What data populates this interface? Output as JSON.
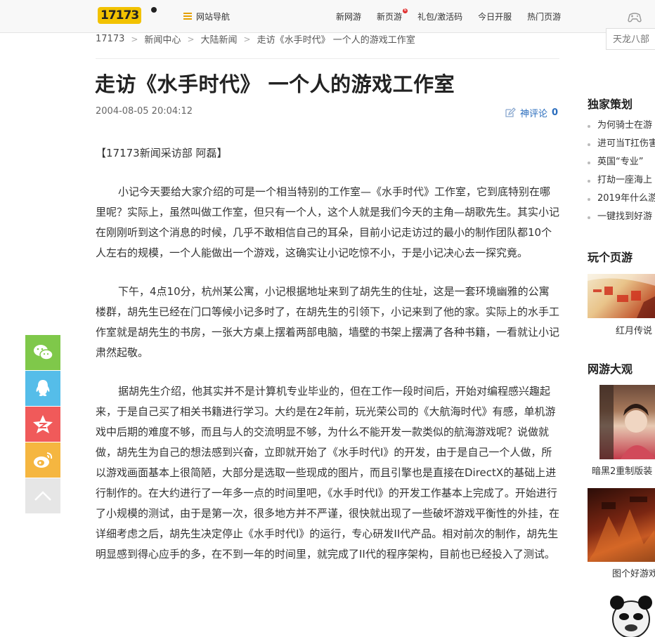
{
  "header": {
    "logo_text": "17173",
    "site_nav_label": "网站导航",
    "menu": [
      {
        "label": "新网游",
        "badge": false
      },
      {
        "label": "新页游",
        "badge": true
      },
      {
        "label": "礼包/激活码",
        "badge": false
      },
      {
        "label": "今日开服",
        "badge": false
      },
      {
        "label": "热门页游",
        "badge": false
      }
    ]
  },
  "breadcrumb": [
    "17173",
    "新闻中心",
    "大陆新闻",
    "走访《水手时代》 一个人的游戏工作室"
  ],
  "search": {
    "placeholder": "天龙八部"
  },
  "article": {
    "title": "走访《水手时代》 一个人的游戏工作室",
    "date": "2004-08-05 20:04:12",
    "comment_label": "神评论",
    "comment_count": "0",
    "paragraphs": [
      "【17173新闻采访部 阿磊】",
      "小记今天要给大家介绍的可是一个相当特别的工作室—《水手时代》工作室，它到底特别在哪里呢？实际上，虽然叫做工作室，但只有一个人，这个人就是我们今天的主角—胡歌先生。其实小记在刚刚听到这个消息的时候，几乎不敢相信自己的耳朵，目前小记走访过的最小的制作团队都10个人左右的规模，一个人能做出一个游戏，这确实让小记吃惊不小，于是小记决心去一探究竟。",
      "下午，4点10分，杭州某公寓，小记根据地址来到了胡先生的住址，这是一套环境幽雅的公寓楼群，胡先生已经在门口等候小记多时了，在胡先生的引领下，小记来到了他的家。实际上的水手工作室就是胡先生的书房，一张大方桌上摆着两部电脑，墙壁的书架上摆满了各种书籍，一看就让小记肃然起敬。",
      "据胡先生介绍，他其实并不是计算机专业毕业的，但在工作一段时间后，开始对编程感兴趣起来，于是自己买了相关书籍进行学习。大约是在2年前，玩光荣公司的《大航海时代》有感，单机游戏中后期的难度不够，而且与人的交流明显不够，为什么不能开发一款类似的航海游戏呢？说做就做，胡先生为自己的想法感到兴奋，立即就开始了《水手时代I》的开发，由于是自己一个人做，所以游戏画面基本上很简陋，大部分是选取一些现成的图片，而且引擎也是直接在DirectX的基础上进行制作的。在大约进行了一年多一点的时间里吧，《水手时代I》的开发工作基本上完成了。开始进行了小规模的测试，由于是第一次，很多地方并不严谨，很快就出现了一些破坏游戏平衡性的外挂，在详细考虑之后，胡先生决定停止《水手时代I》的运行，专心研发II代产品。相对前次的制作，胡先生明显感到得心应手的多，在不到一年的时间里，就完成了II代的程序架构，目前也已经投入了测试。"
    ]
  },
  "share": [
    "wechat-icon",
    "qq-icon",
    "qzone-icon",
    "weibo-icon",
    "back-to-top-icon"
  ],
  "sidebar": {
    "exclusive_title": "独家策划",
    "exclusive_items": [
      "为何骑士在游",
      "进可当T扛伤害",
      "英国“专业”",
      "打劫一座海上",
      "2019年什么游",
      "一键找到好游"
    ],
    "webgame_title": "玩个页游",
    "webgame_caption": "红月传说",
    "mmo_title": "网游大观",
    "mmo_caption_1": "暗黑2重制版装",
    "mmo_caption_2": "图个好游戏"
  }
}
